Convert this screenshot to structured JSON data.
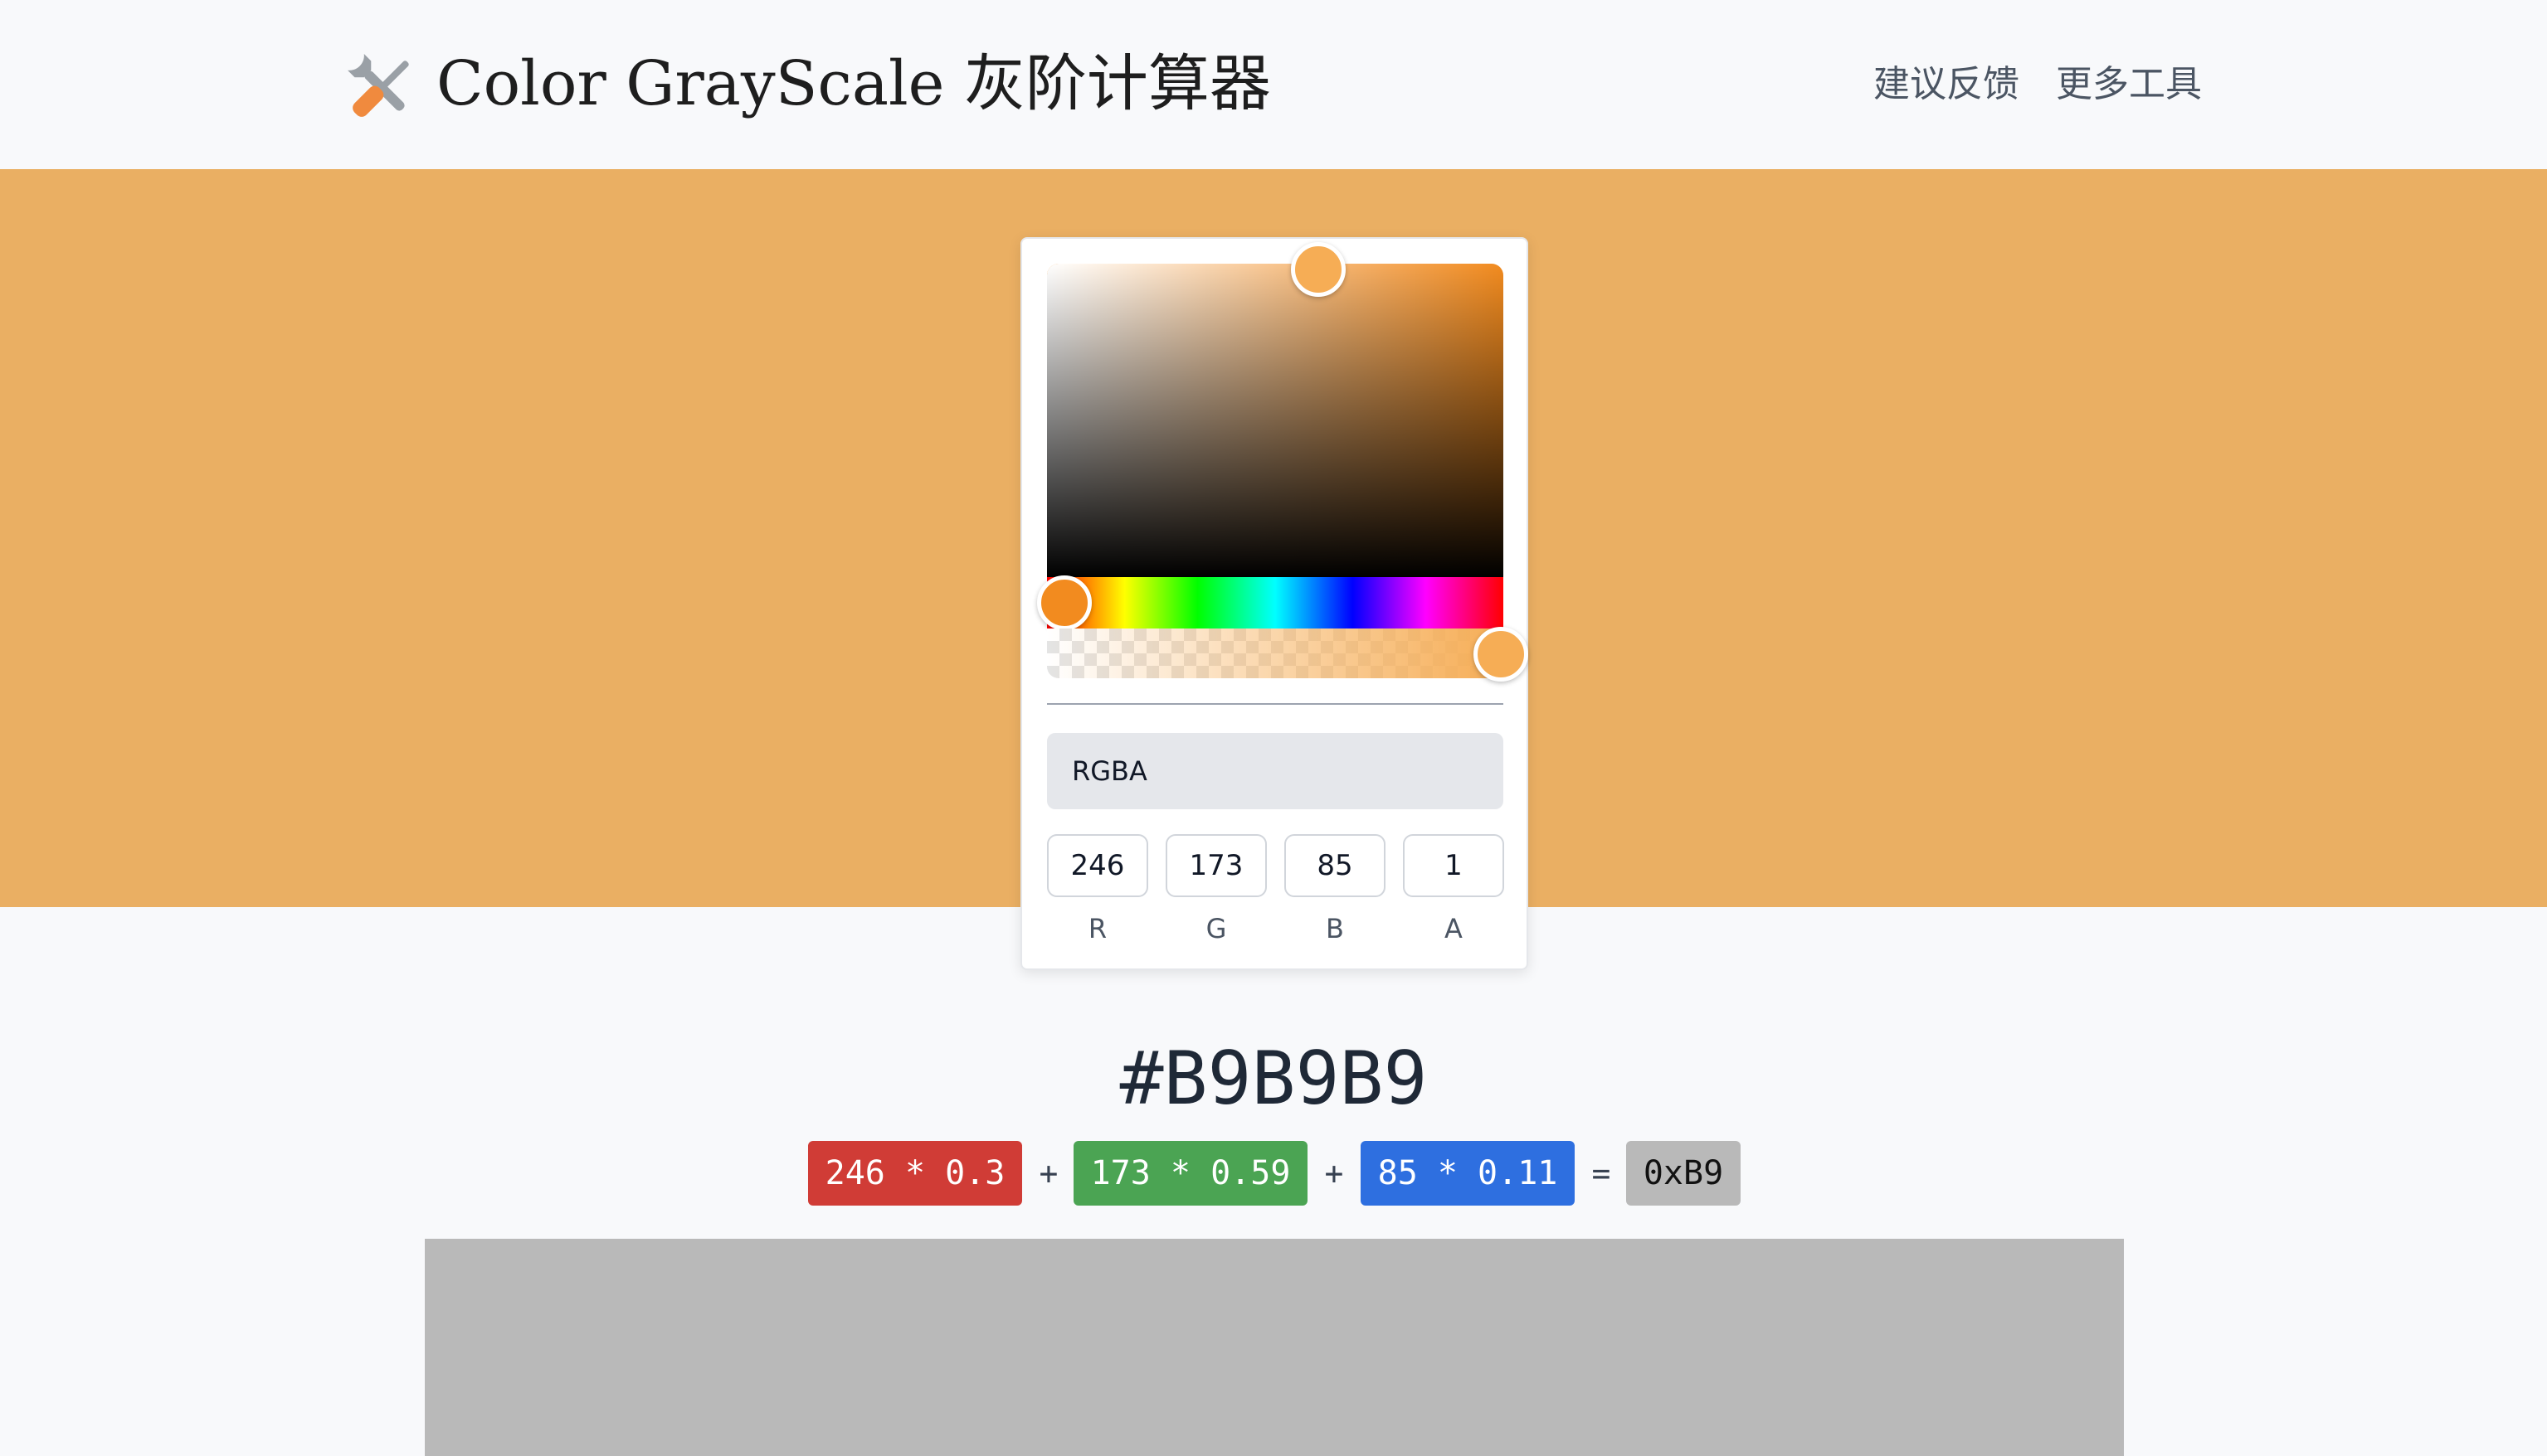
{
  "header": {
    "title": "Color GrayScale 灰阶计算器",
    "logo_icon": "tools-icon",
    "nav": [
      {
        "label": "建议反馈"
      },
      {
        "label": "更多工具"
      }
    ]
  },
  "colors": {
    "selected": "#F6AD55",
    "hero_background": "#EAAF63",
    "pure_hue": "#F28B1F",
    "gray_result": "#B9B9B9"
  },
  "picker": {
    "mode": "RGBA",
    "channels": [
      {
        "label": "R",
        "value": "246"
      },
      {
        "label": "G",
        "value": "173"
      },
      {
        "label": "B",
        "value": "85"
      },
      {
        "label": "A",
        "value": "1"
      }
    ]
  },
  "result": {
    "hex": "#B9B9B9",
    "formula": {
      "r_term": "246 * 0.3",
      "g_term": "173 * 0.59",
      "b_term": "85 * 0.11",
      "plus": "+",
      "equals": "=",
      "gray_hex": "0xB9",
      "r_color": "#D03C36",
      "g_color": "#4BA453",
      "b_color": "#2E6FE0"
    }
  }
}
